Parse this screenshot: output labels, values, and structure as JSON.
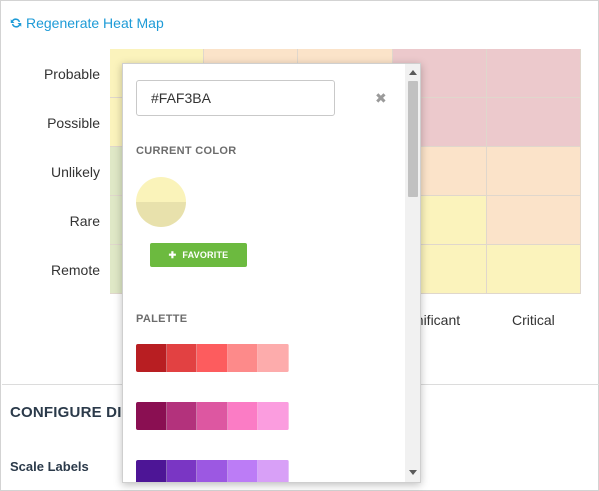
{
  "toolbar": {
    "regenerate_label": "Regenerate Heat Map"
  },
  "heatmap": {
    "row_labels": [
      "Probable",
      "Possible",
      "Unlikely",
      "Rare",
      "Remote"
    ],
    "col_labels_visible": [
      "gnificant",
      "Critical"
    ],
    "colors": {
      "red": "#ecc9cc",
      "orange": "#fbe3c9",
      "yellow": "#fbf3bc",
      "green": "#dfe8c6"
    },
    "cells": [
      [
        "yellow",
        "orange",
        "orange",
        "red",
        "red"
      ],
      [
        "yellow",
        "orange",
        "orange",
        "red",
        "red"
      ],
      [
        "green",
        "yellow",
        "orange",
        "orange",
        "orange"
      ],
      [
        "green",
        "yellow",
        "yellow",
        "yellow",
        "orange"
      ],
      [
        "green",
        "green",
        "yellow",
        "yellow",
        "yellow"
      ]
    ]
  },
  "configure": {
    "heading": "CONFIGURE DI",
    "scale_labels": "Scale Labels"
  },
  "color_picker": {
    "hex_value": "#FAF3BA",
    "current_color_title": "CURRENT COLOR",
    "current_color": "#FAF3BA",
    "favorite_label": "FAVORITE",
    "palette_title": "PALETTE",
    "palette_rows": [
      [
        "#b81e22",
        "#e24142",
        "#fd5c5e",
        "#fd8a8a",
        "#fdacac"
      ],
      [
        "#8a0f52",
        "#b3327c",
        "#dd57a1",
        "#fb7cc5",
        "#fb9ddf"
      ],
      [
        "#4d1596",
        "#7a36c4",
        "#9c58e2",
        "#bc7cf6",
        "#d8a0f7"
      ]
    ]
  }
}
